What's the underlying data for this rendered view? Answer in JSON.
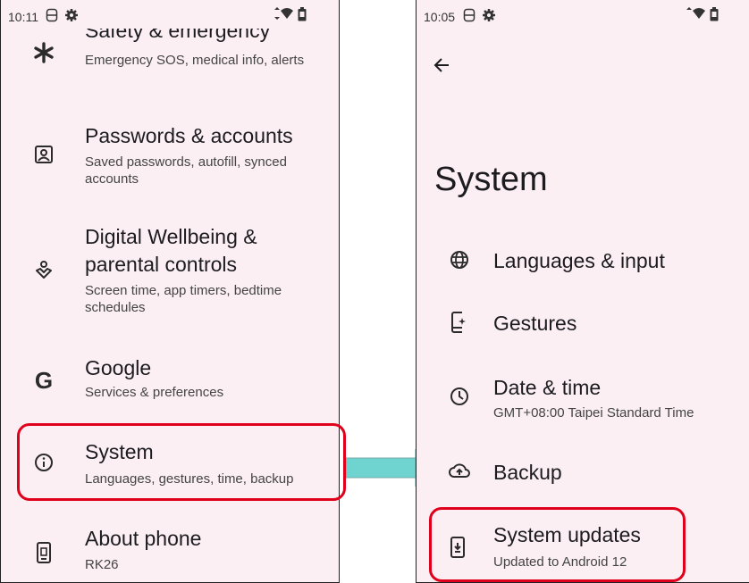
{
  "left": {
    "status": {
      "time": "10:11"
    },
    "items": [
      {
        "title": "Safety & emergency",
        "sub": "Emergency SOS, medical info, alerts",
        "icon": "asterisk-icon"
      },
      {
        "title": "Passwords & accounts",
        "sub": "Saved passwords, autofill, synced accounts",
        "icon": "account-box-icon"
      },
      {
        "title": "Digital Wellbeing &",
        "title2": "parental controls",
        "sub": "Screen time, app timers, bedtime schedules",
        "icon": "wellbeing-icon"
      },
      {
        "title": "Google",
        "sub": "Services & preferences",
        "icon": "google-g-icon"
      },
      {
        "title": "System",
        "sub": "Languages, gestures, time, backup",
        "icon": "info-icon"
      },
      {
        "title": "About phone",
        "sub": "RK26",
        "icon": "phone-icon"
      }
    ]
  },
  "right": {
    "status": {
      "time": "10:05"
    },
    "page_title": "System",
    "items": [
      {
        "title": "Languages & input",
        "icon": "globe-icon"
      },
      {
        "title": "Gestures",
        "icon": "gestures-icon"
      },
      {
        "title": "Date & time",
        "sub": "GMT+08:00 Taipei Standard Time",
        "icon": "clock-icon"
      },
      {
        "title": "Backup",
        "icon": "cloud-upload-icon"
      },
      {
        "title": "System updates",
        "sub": "Updated to Android 12",
        "icon": "system-update-icon"
      }
    ]
  },
  "colors": {
    "highlight": "#e0001b",
    "arrow": "#6fd3d0",
    "background": "#fbeff3"
  }
}
